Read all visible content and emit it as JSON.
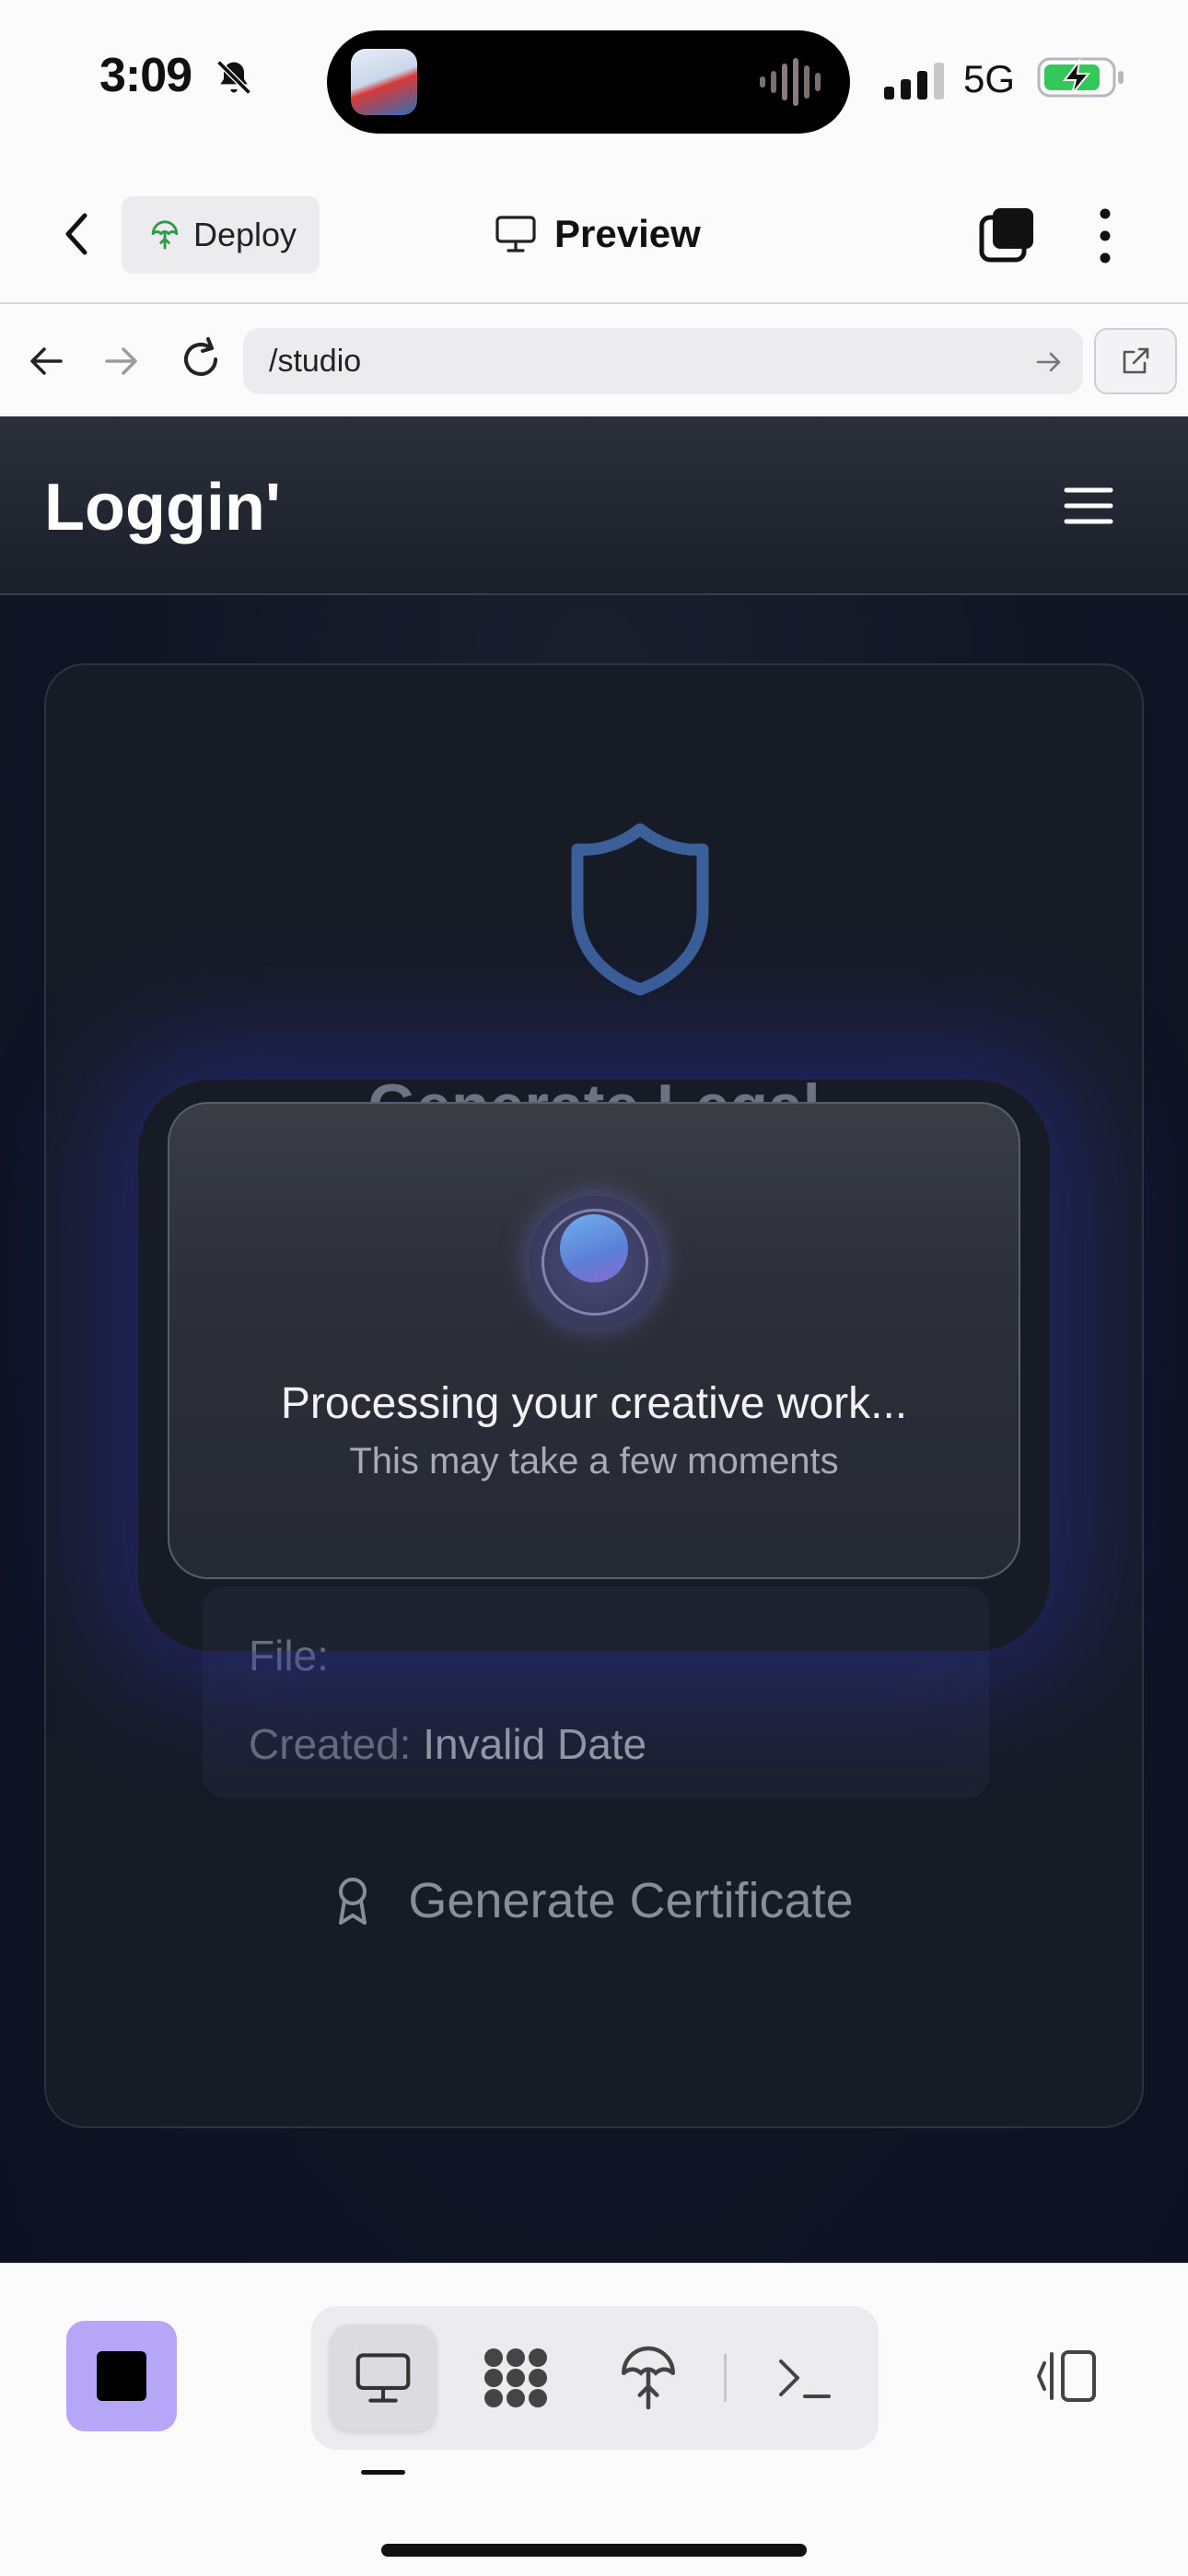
{
  "status_bar": {
    "time": "3:09",
    "network": "5G"
  },
  "toolbar": {
    "deploy_label": "Deploy",
    "preview_label": "Preview"
  },
  "browser": {
    "url": "/studio"
  },
  "site": {
    "brand": "Loggin'"
  },
  "card": {
    "heading": "Generate Legal",
    "file_label": "File:",
    "file_value": "",
    "created_label": "Created:",
    "created_value": "Invalid Date",
    "generate_button": "Generate Certificate"
  },
  "modal": {
    "title": "Processing your creative work...",
    "subtitle": "This may take a few moments"
  },
  "dock": {
    "active_tab": "preview"
  },
  "colors": {
    "accent_stop": "#b5a6f7",
    "page_background": "#111524",
    "shield": "#3b5f99",
    "deploy_icon": "#2e9a4a"
  }
}
